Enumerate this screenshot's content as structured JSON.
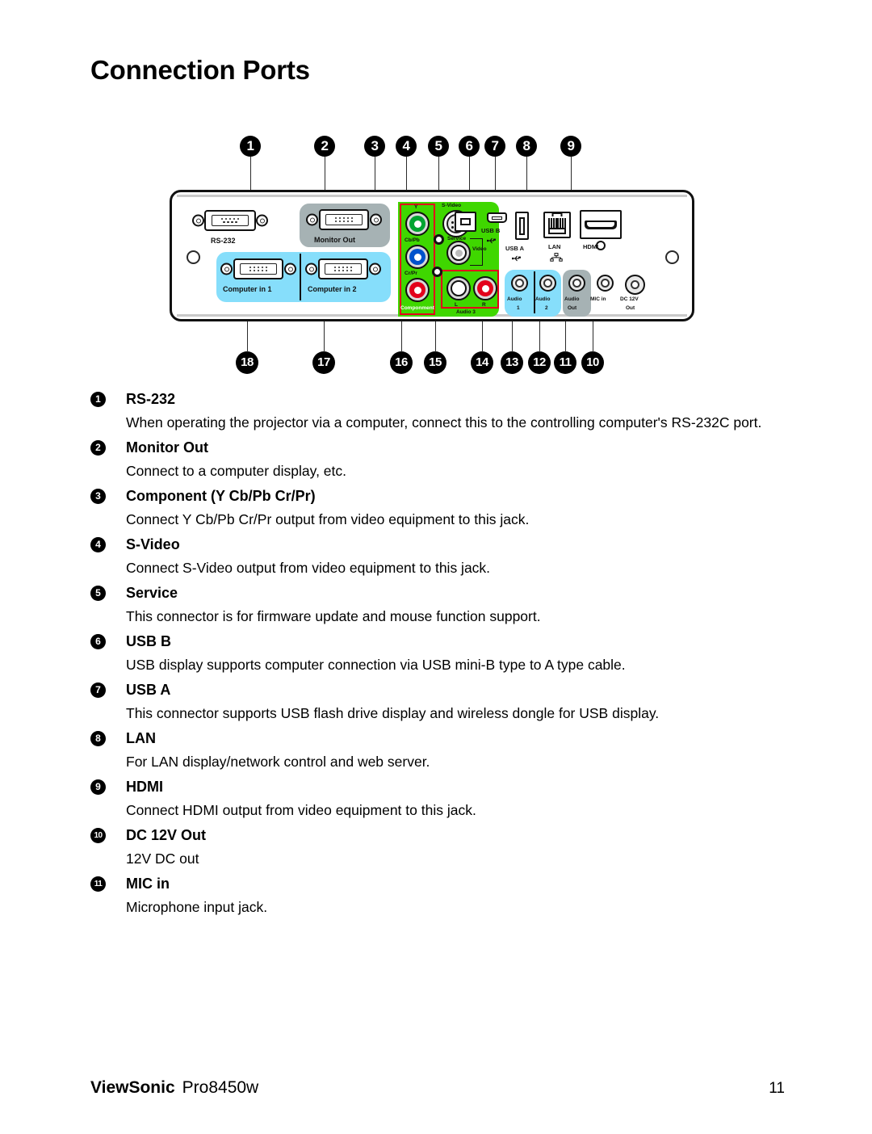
{
  "page": {
    "title": "Connection Ports"
  },
  "figure": {
    "alt": "projector rear connection panel diagram",
    "callouts_top": [
      "1",
      "2",
      "3",
      "4",
      "5",
      "6",
      "7",
      "8",
      "9"
    ],
    "callouts_bottom": [
      "18",
      "17",
      "16",
      "15",
      "14",
      "13",
      "12",
      "11",
      "10"
    ],
    "port_labels": {
      "rs232": "RS-232",
      "monitor_out": "Monitor Out",
      "computer_in_1": "Computer in 1",
      "computer_in_2": "Computer in 2",
      "y": "Y",
      "cbpb": "Cb/Pb",
      "crpr": "Cr/Pr",
      "component": "Componment",
      "svideo": "S-Video",
      "video": "Video",
      "audio3": "Audio 3",
      "audio3_l": "L",
      "audio3_r": "R",
      "service": "Service",
      "usb_b": "USB B",
      "usb_a": "USB A",
      "lan": "LAN",
      "hdmi": "HDMI",
      "audio1": "Audio",
      "audio1_num": "1",
      "audio2": "Audio",
      "audio2_num": "2",
      "audio_out": "Audio",
      "audio_out_num": "Out",
      "mic_in": "MIC in",
      "dc12v": "DC 12V",
      "dc12v_num": "Out"
    },
    "colors": {
      "green_panel": "#3FD700",
      "cyan_panel": "#86DEFB",
      "gray_panel": "#A6B2B4",
      "red_outline": "#E3001B",
      "jack_green": "#00A431",
      "jack_blue": "#0052CC",
      "jack_red": "#E3001B"
    }
  },
  "descriptions": [
    {
      "num": "1",
      "term": "RS-232",
      "body": "When operating the projector via a computer, connect this to the controlling computer's RS-232C port."
    },
    {
      "num": "2",
      "term": "Monitor Out",
      "body": "Connect to a computer display, etc."
    },
    {
      "num": "3",
      "term": "Component (Y Cb/Pb Cr/Pr)",
      "body": "Connect Y Cb/Pb Cr/Pr output from video equipment to this jack."
    },
    {
      "num": "4",
      "term": "S-Video",
      "body": "Connect S-Video output from video equipment to this jack."
    },
    {
      "num": "5",
      "term": "Service",
      "body": "This connector is for firmware update and mouse function support."
    },
    {
      "num": "6",
      "term": "USB B",
      "body": "USB display supports computer connection via USB mini-B type to A type cable."
    },
    {
      "num": "7",
      "term": "USB A",
      "body": "This connector supports USB flash drive display and wireless dongle for USB display."
    },
    {
      "num": "8",
      "term": "LAN",
      "body": "For LAN display/network control and web server."
    },
    {
      "num": "9",
      "term": "HDMI",
      "body": "Connect HDMI output from video equipment to this jack."
    },
    {
      "num": "10",
      "term": "DC 12V Out",
      "body": "12V DC out"
    },
    {
      "num": "11",
      "term": "MIC in",
      "body": "Microphone input jack."
    }
  ],
  "footer": {
    "brand": "ViewSonic",
    "model": "Pro8450w",
    "page_number": "11"
  }
}
